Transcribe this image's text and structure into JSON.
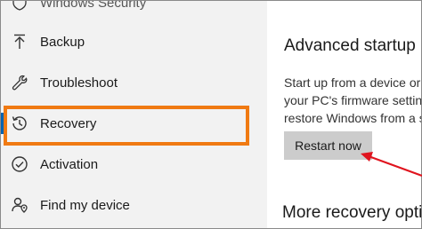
{
  "sidebar": {
    "items": [
      {
        "label": "Windows Security",
        "icon": "shield-icon"
      },
      {
        "label": "Backup",
        "icon": "backup-arrow-icon"
      },
      {
        "label": "Troubleshoot",
        "icon": "wrench-icon"
      },
      {
        "label": "Recovery",
        "icon": "recovery-history-icon",
        "selected": true
      },
      {
        "label": "Activation",
        "icon": "checkmark-circle-icon"
      },
      {
        "label": "Find my device",
        "icon": "person-location-icon"
      }
    ]
  },
  "main": {
    "advanced_startup": {
      "title": "Advanced startup",
      "description_lines": [
        "Start up from a device or",
        "your PC's firmware setting",
        "restore Windows from a s"
      ],
      "button_label": "Restart now"
    },
    "more_recovery_title": "More recovery opti"
  },
  "annotation": {
    "highlight_color": "#f07a12",
    "arrow_color": "#e0141e"
  },
  "colors": {
    "sidebar_bg": "#f2f2f2",
    "button_bg": "#cccccc",
    "selection_accent": "#0063b1"
  }
}
